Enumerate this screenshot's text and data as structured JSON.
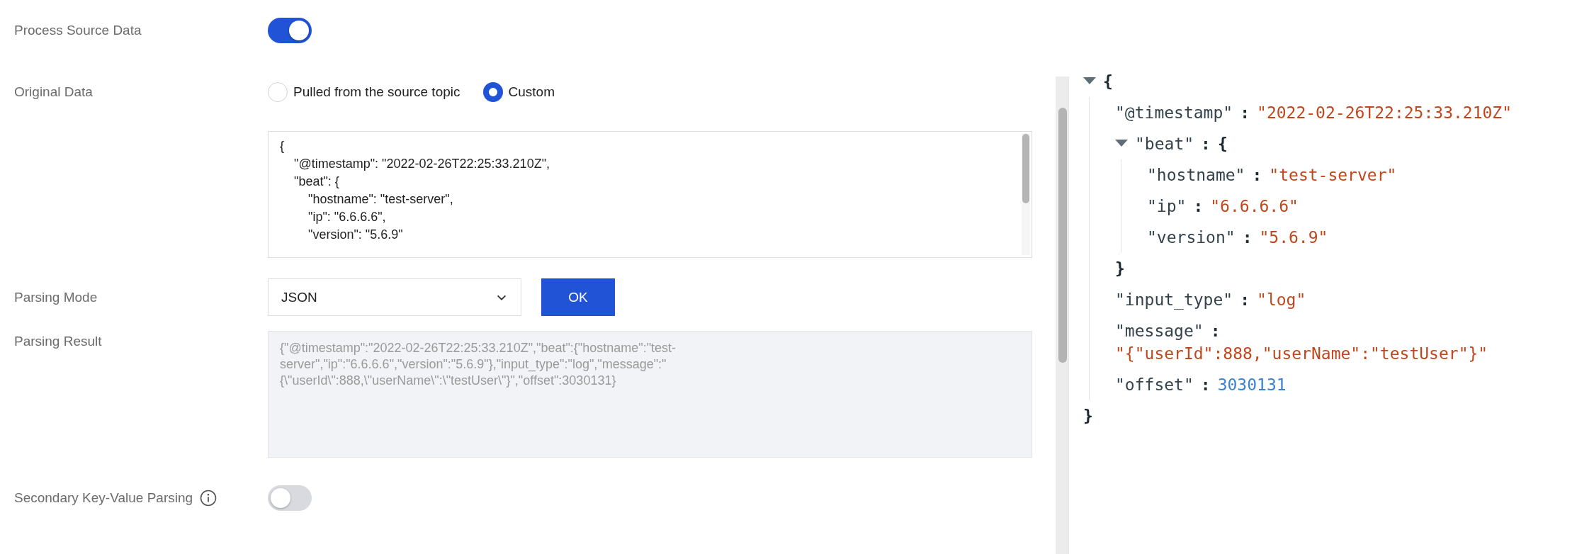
{
  "process_source": {
    "label": "Process Source Data",
    "on": true
  },
  "original_data": {
    "label": "Original Data",
    "options": [
      {
        "label": "Pulled from the source topic",
        "selected": false
      },
      {
        "label": "Custom",
        "selected": true
      }
    ],
    "editor_lines": [
      "{",
      "    \"@timestamp\": \"2022-02-26T22:25:33.210Z\",",
      "    \"beat\": {",
      "        \"hostname\": \"test-server\",",
      "        \"ip\": \"6.6.6.6\",",
      "        \"version\": \"5.6.9\""
    ]
  },
  "parsing_mode": {
    "label": "Parsing Mode",
    "value": "JSON",
    "button": "OK"
  },
  "parsing_result": {
    "label": "Parsing Result",
    "value": "{\"@timestamp\":\"2022-02-26T22:25:33.210Z\",\"beat\":{\"hostname\":\"test-server\",\"ip\":\"6.6.6.6\",\"version\":\"5.6.9\"},\"input_type\":\"log\",\"message\":\"{\\\"userId\\\":888,\\\"userName\\\":\\\"testUser\\\"}\",\"offset\":3030131}"
  },
  "secondary_parsing": {
    "label": "Secondary Key-Value Parsing",
    "on": false
  },
  "tree": {
    "open": "{",
    "close": "}",
    "expanded": true,
    "children": [
      {
        "key": "\"@timestamp\"",
        "colon": ":",
        "value": "\"2022-02-26T22:25:33.210Z\"",
        "kind": "string"
      },
      {
        "key": "\"beat\"",
        "colon": ":",
        "open": "{",
        "close": "}",
        "expanded": true,
        "children": [
          {
            "key": "\"hostname\"",
            "colon": ":",
            "value": "\"test-server\"",
            "kind": "string"
          },
          {
            "key": "\"ip\"",
            "colon": ":",
            "value": "\"6.6.6.6\"",
            "kind": "string"
          },
          {
            "key": "\"version\"",
            "colon": ":",
            "value": "\"5.6.9\"",
            "kind": "string"
          }
        ]
      },
      {
        "key": "\"input_type\"",
        "colon": ":",
        "value": "\"log\"",
        "kind": "string"
      },
      {
        "key": "\"message\"",
        "colon": ":",
        "value": "\"{\"userId\":888,\"userName\":\"testUser\"}\"",
        "kind": "string"
      },
      {
        "key": "\"offset\"",
        "colon": ":",
        "value": "3030131",
        "kind": "number"
      }
    ]
  }
}
